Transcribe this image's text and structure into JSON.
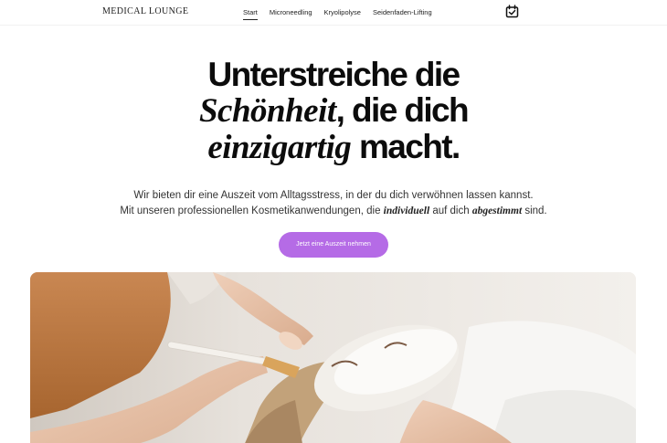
{
  "header": {
    "logo": "MEDICAL LOUNGE",
    "nav": [
      "Start",
      "Microneedling",
      "Kryolipolyse",
      "Seidenfaden-Lifting"
    ],
    "active_nav": "Start",
    "booking_icon": "calendar-check-icon"
  },
  "hero": {
    "headline": {
      "line1": "Unterstreiche die",
      "line2_serif": "Schönheit",
      "line2_rest": ", die dich",
      "line3_serif": "einzigartig",
      "line3_rest": " macht."
    },
    "subtext": {
      "line1": "Wir bieten dir eine Auszeit vom Alltagsstress, in der du dich verwöhnen lassen kannst.",
      "line2_start": "Mit unseren professionellen Kosmetikanwendungen, die ",
      "line2_emph1": "individuell",
      "line2_mid": " auf dich ",
      "line2_emph2": "abgestimmt",
      "line2_end": " sind."
    },
    "cta_label": "Jetzt eine Auszeit nehmen"
  },
  "colors": {
    "accent": "#b56be6",
    "text": "#0c0c0c"
  }
}
